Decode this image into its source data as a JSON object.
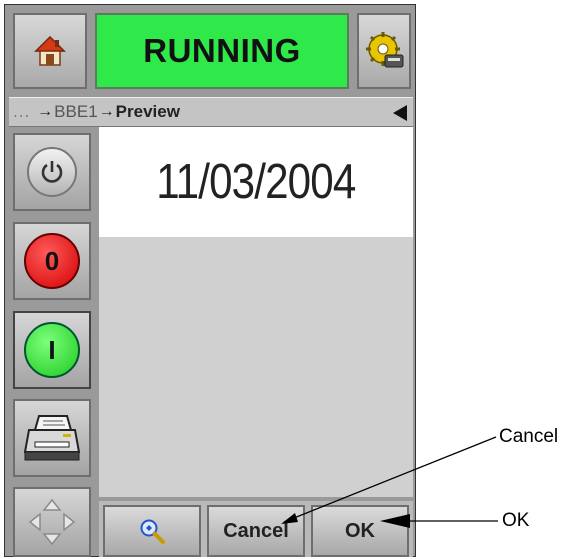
{
  "status": {
    "text": "RUNNING",
    "color": "#2fe84a"
  },
  "breadcrumb": {
    "ellipsis": "...",
    "separator": "→",
    "items": [
      "BBE1",
      "Preview"
    ]
  },
  "preview": {
    "content_text": "11/03/2004"
  },
  "side_buttons": {
    "stop_label": "0",
    "start_label": "I"
  },
  "bottom_buttons": {
    "cancel_label": "Cancel",
    "ok_label": "OK"
  },
  "callouts": {
    "cancel": "Cancel",
    "ok": "OK"
  },
  "icons": {
    "home": "home-icon",
    "settings": "settings-gear-icon",
    "power": "power-icon",
    "print": "printer-icon",
    "nav": "navigation-arrows-icon",
    "zoom": "zoom-icon",
    "back": "back-arrow-icon"
  }
}
